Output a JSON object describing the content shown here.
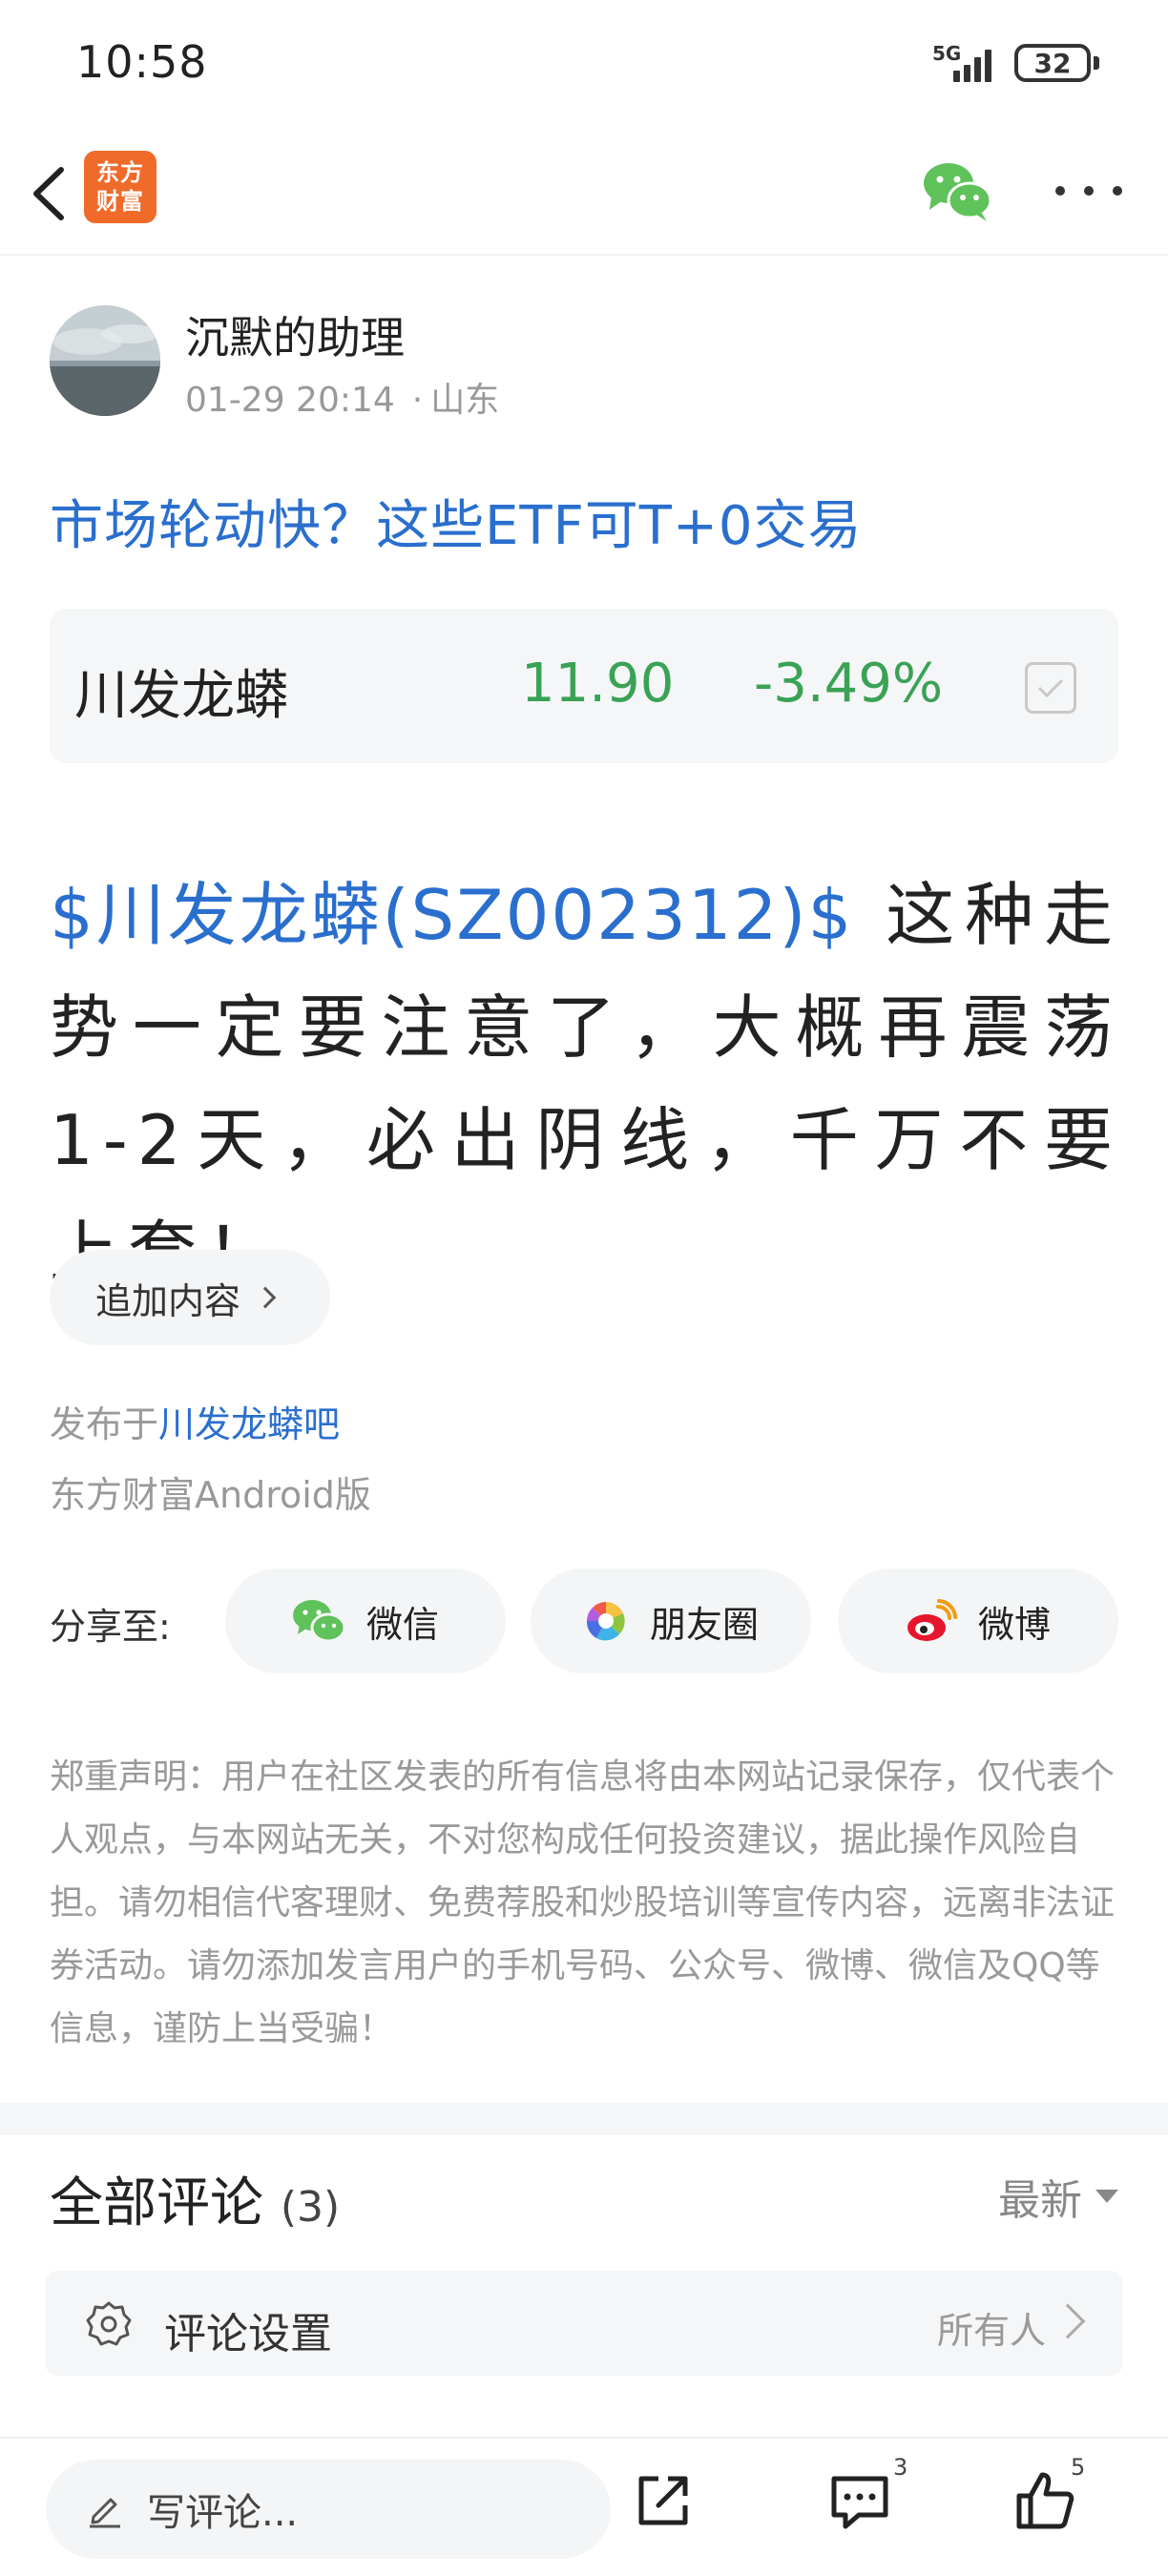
{
  "status": {
    "time": "10:58",
    "network": "5G",
    "battery": "32"
  },
  "nav": {
    "logo_text": "东方\n财富",
    "wechat_icon": "wechat-icon",
    "more_icon": "more-icon"
  },
  "author": {
    "name": "沉默的助理",
    "time": "01-29 20:14",
    "separator": "·",
    "location": "山东"
  },
  "post": {
    "title": "市场轮动快？这些ETF可T+0交易",
    "stock": {
      "name": "川发龙蟒",
      "price": "11.90",
      "change": "-3.49%"
    },
    "body_link": "$川发龙蟒(SZ002312)$",
    "body_text": " 这种走势一定要注意了，大概再震荡1-2天，必出阴线，千万不要上套！",
    "append_label": "追加内容",
    "published_prefix": "发布于",
    "published_bar": "川发龙蟒吧",
    "client": "东方财富Android版"
  },
  "share": {
    "label": "分享至:",
    "wechat": "微信",
    "moments": "朋友圈",
    "weibo": "微博"
  },
  "disclaimer": "郑重声明：用户在社区发表的所有信息将由本网站记录保存，仅代表个人观点，与本网站无关，不对您构成任何投资建议，据此操作风险自担。请勿相信代客理财、免费荐股和炒股培训等宣传内容，远离非法证券活动。请勿添加发言用户的手机号码、公众号、微博、微信及QQ等信息，谨防上当受骗！",
  "comments": {
    "title": "全部评论",
    "count": "(3)",
    "sort": "最新",
    "settings_label": "评论设置",
    "settings_value": "所有人"
  },
  "bottom": {
    "write_placeholder": "写评论...",
    "comment_count": "3",
    "like_count": "5"
  },
  "colors": {
    "link_blue": "#2a6fce",
    "down_green": "#3aa255",
    "brand_orange": "#f06a2a"
  }
}
